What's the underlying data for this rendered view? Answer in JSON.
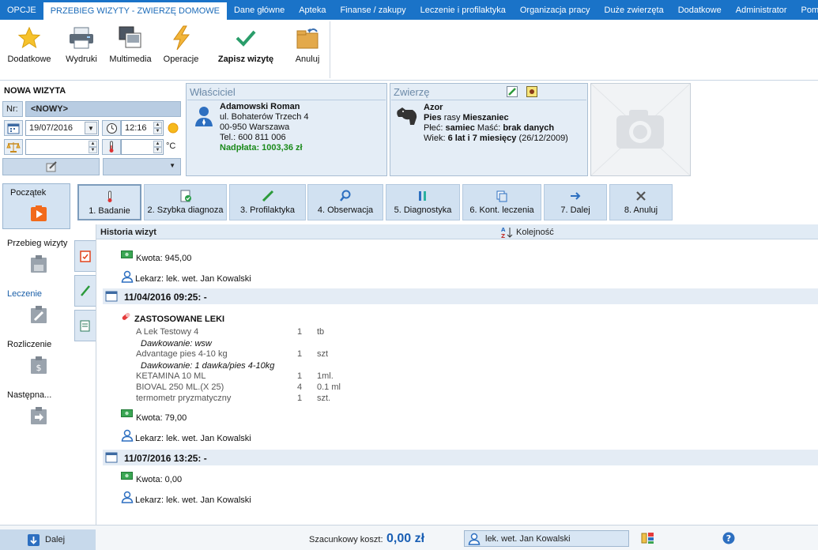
{
  "menu": {
    "items": [
      "OPCJE",
      "PRZEBIEG WIZYTY - ZWIERZĘ DOMOWE",
      "Dane główne",
      "Apteka",
      "Finanse / zakupy",
      "Leczenie i profilaktyka",
      "Organizacja pracy",
      "Duże zwierzęta",
      "Dodatkowe",
      "Administrator",
      "Pomoc"
    ],
    "active_index": 1
  },
  "ribbon": {
    "dodatkowe": "Dodatkowe",
    "wydruki": "Wydruki",
    "multimedia": "Multimedia",
    "operacje": "Operacje",
    "zapisz": "Zapisz wizytę",
    "anuluj": "Anuluj"
  },
  "visit": {
    "title": "NOWA WIZYTA",
    "nr_label": "Nr:",
    "nr_value": "<NOWY>",
    "date": "19/07/2016",
    "time": "12:16",
    "weight": "",
    "temperature": "",
    "temp_unit": "°C",
    "dropdown_value": ""
  },
  "owner": {
    "header": "Właściciel",
    "name": "Adamowski Roman",
    "street": "ul. Bohaterów Trzech 4",
    "city": "00-950  Warszawa",
    "phone": "Tel.: 600 811 006",
    "overpayment": "Nadpłata: 1003,36 zł"
  },
  "animal": {
    "header": "Zwierzę",
    "name": "Azor",
    "species": "Pies",
    "breed_label": "rasy",
    "breed": "Mieszaniec",
    "sex_label": "Płeć:",
    "sex": "samiec",
    "color_label": "Maść:",
    "color": "brak danych",
    "age_label": "Wiek:",
    "age": "6 lat i 7 miesięcy",
    "birth": "(26/12/2009)"
  },
  "nav": {
    "poczatek": "Początek",
    "przebieg": "Przebieg wizyty",
    "leczenie": "Leczenie",
    "rozliczenie": "Rozliczenie",
    "nastepna": "Następna..."
  },
  "steps": [
    "1. Badanie",
    "2. Szybka diagnoza",
    "3. Profilaktyka",
    "4. Obserwacja",
    "5. Diagnostyka",
    "6. Kont. leczenia",
    "7. Dalej",
    "8. Anuluj"
  ],
  "history": {
    "title": "Historia wizyt",
    "sort_label": "Kolejność",
    "kwota1": "Kwota: 945,00",
    "lekarz1": "Lekarz: lek. wet. Jan Kowalski",
    "date2": "11/04/2016 09:25: -",
    "leki_header": "ZASTOSOWANE LEKI",
    "meds": [
      {
        "name": "A Lek Testowy 4",
        "qty": "1",
        "unit": "tb"
      },
      {
        "name": "Advantage pies 4-10 kg",
        "qty": "1",
        "unit": "szt"
      },
      {
        "name": "KETAMINA 10 ML",
        "qty": "1",
        "unit": "1ml."
      },
      {
        "name": "BIOVAL 250 ML.(X 25)",
        "qty": "4",
        "unit": "0.1 ml"
      },
      {
        "name": "termometr pryzmatyczny",
        "qty": "1",
        "unit": "szt."
      }
    ],
    "dose1": "Dawkowanie: wsw",
    "dose2": "Dawkowanie: 1 dawka/pies 4-10kg",
    "kwota2": "Kwota: 79,00",
    "lekarz2": "Lekarz: lek. wet. Jan Kowalski",
    "date3": "11/07/2016 13:25: -",
    "kwota3": "Kwota: 0,00",
    "lekarz3": "Lekarz: lek. wet. Jan Kowalski"
  },
  "status": {
    "dalej": "Dalej",
    "cost_label": "Szacunkowy koszt:",
    "cost_value": "0,00 zł",
    "doctor": "lek. wet. Jan Kowalski"
  }
}
